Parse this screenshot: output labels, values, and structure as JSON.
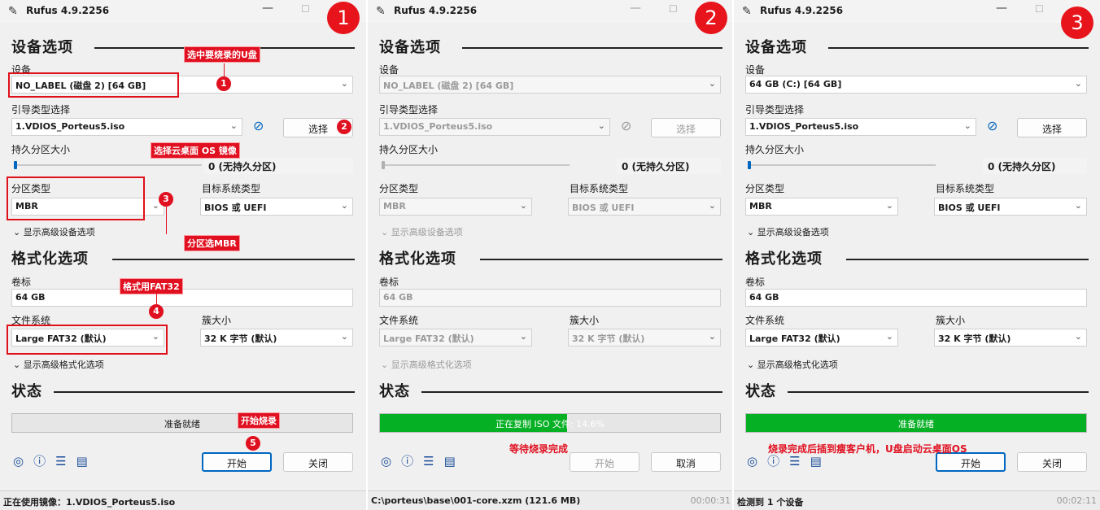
{
  "app_title": "Rufus 4.9.2256",
  "icons": {
    "app": "pen-usb-icon",
    "minimize": "minimize-icon",
    "maximize": "maximize-icon",
    "chevron": "chevron-down-icon",
    "verify": "check-circle-icon",
    "globe": "globe-icon",
    "info": "info-icon",
    "settings": "sliders-icon",
    "log": "log-icon"
  },
  "colors": {
    "accent": "#0067c0",
    "progress": "#06b025",
    "callout": "#e01020"
  },
  "labels": {
    "device_section": "设备选项",
    "device": "设备",
    "boot_selection": "引导类型选择",
    "persistent": "持久分区大小",
    "partition_scheme": "分区类型",
    "target_system": "目标系统类型",
    "adv_device": "显示高级设备选项",
    "format_section": "格式化选项",
    "volume_label": "卷标",
    "file_system": "文件系统",
    "cluster_size": "簇大小",
    "adv_format": "显示高级格式化选项",
    "status_section": "状态",
    "select": "选择",
    "start": "开始",
    "close": "关闭",
    "cancel": "取消"
  },
  "panels": [
    {
      "badge": "1",
      "device": "NO_LABEL (磁盘 2) [64 GB]",
      "boot": "1.VDIOS_Porteus5.iso",
      "persistent_value": "0 (无持久分区)",
      "partition": "MBR",
      "target": "BIOS 或 UEFI",
      "volume": "64 GB",
      "filesystem": "Large FAT32 (默认)",
      "cluster": "32 K 字节 (默认)",
      "status": "准备就绪",
      "status_progress": 0,
      "right_button": "关闭",
      "footer": "正在使用镜像：1.VDIOS_Porteus5.iso",
      "footer_time": ""
    },
    {
      "badge": "2",
      "device": "NO_LABEL (磁盘 2) [64 GB]",
      "boot": "1.VDIOS_Porteus5.iso",
      "persistent_value": "0 (无持久分区)",
      "partition": "MBR",
      "target": "BIOS 或 UEFI",
      "volume": "64 GB",
      "filesystem": "Large FAT32 (默认)",
      "cluster": "32 K 字节 (默认)",
      "status": "正在复制 ISO 文件: 14.6%",
      "status_progress": 0.55,
      "right_button": "取消",
      "footer": "C:\\porteus\\base\\001-core.xzm (121.6 MB)",
      "footer_time": "00:00:31"
    },
    {
      "badge": "3",
      "device": "64 GB (C:) [64 GB]",
      "boot": "1.VDIOS_Porteus5.iso",
      "persistent_value": "0 (无持久分区)",
      "partition": "MBR",
      "target": "BIOS 或 UEFI",
      "volume": "64 GB",
      "filesystem": "Large FAT32 (默认)",
      "cluster": "32 K 字节 (默认)",
      "status": "准备就绪",
      "status_progress": 1,
      "right_button": "关闭",
      "footer": "检测到 1 个设备",
      "footer_time": "00:02:11"
    }
  ],
  "annotations": {
    "select_usb": "选中要烧录的U盘",
    "select_os": "选择云桌面 OS 镜像",
    "mbr": "分区选MBR",
    "fat32": "格式用FAT32",
    "start_burn": "开始烧录",
    "wait": "等待烧录完成",
    "done": "烧录完成后插到瘦客户机，U盘启动云桌面OS",
    "n1": "1",
    "n2": "2",
    "n3": "3",
    "n4": "4",
    "n5": "5"
  }
}
